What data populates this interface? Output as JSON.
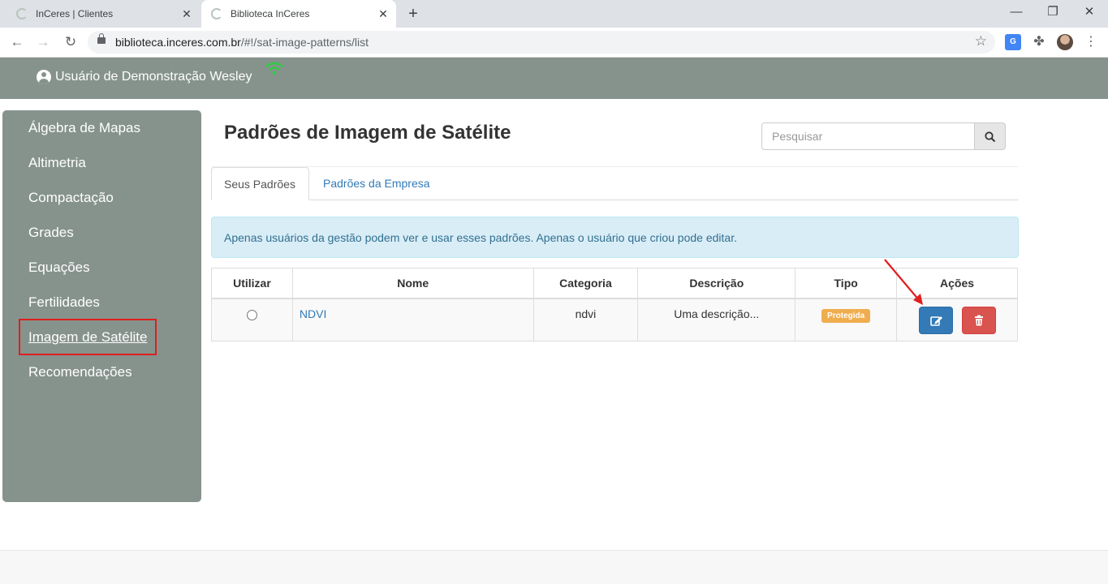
{
  "browser": {
    "tabs": [
      {
        "title": "InCeres | Clientes",
        "active": false
      },
      {
        "title": "Biblioteca InCeres",
        "active": true
      }
    ],
    "url_host": "biblioteca.inceres.com.br",
    "url_path": "/#!/sat-image-patterns/list"
  },
  "header": {
    "user_name": "Usuário de Demonstração Wesley",
    "wifi_color": "#2ecc40"
  },
  "sidebar": {
    "items": [
      {
        "label": "Álgebra de Mapas"
      },
      {
        "label": "Altimetria"
      },
      {
        "label": "Compactação"
      },
      {
        "label": "Grades"
      },
      {
        "label": "Equações"
      },
      {
        "label": "Fertilidades"
      },
      {
        "label": "Imagem de Satélite",
        "active": true
      },
      {
        "label": "Recomendações"
      }
    ]
  },
  "main": {
    "title": "Padrões de Imagem de Satélite",
    "search": {
      "placeholder": "Pesquisar"
    },
    "tabs": [
      {
        "label": "Seus Padrões",
        "active": true
      },
      {
        "label": "Padrões da Empresa",
        "active": false
      }
    ],
    "alert": "Apenas usuários da gestão podem ver e usar esses padrões. Apenas o usuário que criou pode editar.",
    "table": {
      "headers": [
        "Utilizar",
        "Nome",
        "Categoria",
        "Descrição",
        "Tipo",
        "Ações"
      ],
      "rows": [
        {
          "nome": "NDVI",
          "categoria": "ndvi",
          "descricao": "Uma descrição...",
          "tipo": "Protegida"
        }
      ]
    }
  },
  "colors": {
    "sidebar_bg": "#86938d",
    "primary": "#337ab7",
    "danger": "#d9534f",
    "warning": "#f0ad4e",
    "highlight": "#e01e1e"
  }
}
